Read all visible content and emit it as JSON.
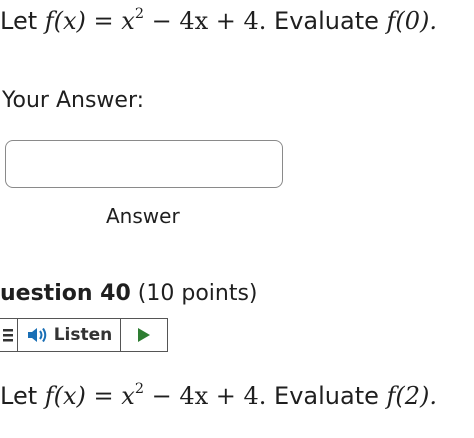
{
  "question_39": {
    "prefix": "Let ",
    "f_of_x": "f(x) = x",
    "exponent": "2",
    "rest": " − 4x + 4.",
    "instruction": " Evaluate ",
    "target": "f(0)."
  },
  "your_answer_label": "Your Answer:",
  "answer_input": {
    "value": "",
    "placeholder": ""
  },
  "answer_label": "Answer",
  "question_40": {
    "title": "uestion 40",
    "points": "(10 points)",
    "prefix": "Let ",
    "f_of_x": "f(x) = x",
    "exponent": "2",
    "rest": " − 4x + 4.",
    "instruction": " Evaluate ",
    "target": "f(2)."
  },
  "listen_toolbar": {
    "menu_icon": "menu-icon",
    "speaker_icon": "speaker-icon",
    "listen_label": "Listen",
    "play_icon": "play-icon",
    "accent_color": "#1a6fb5",
    "play_color": "#2e7d32"
  }
}
